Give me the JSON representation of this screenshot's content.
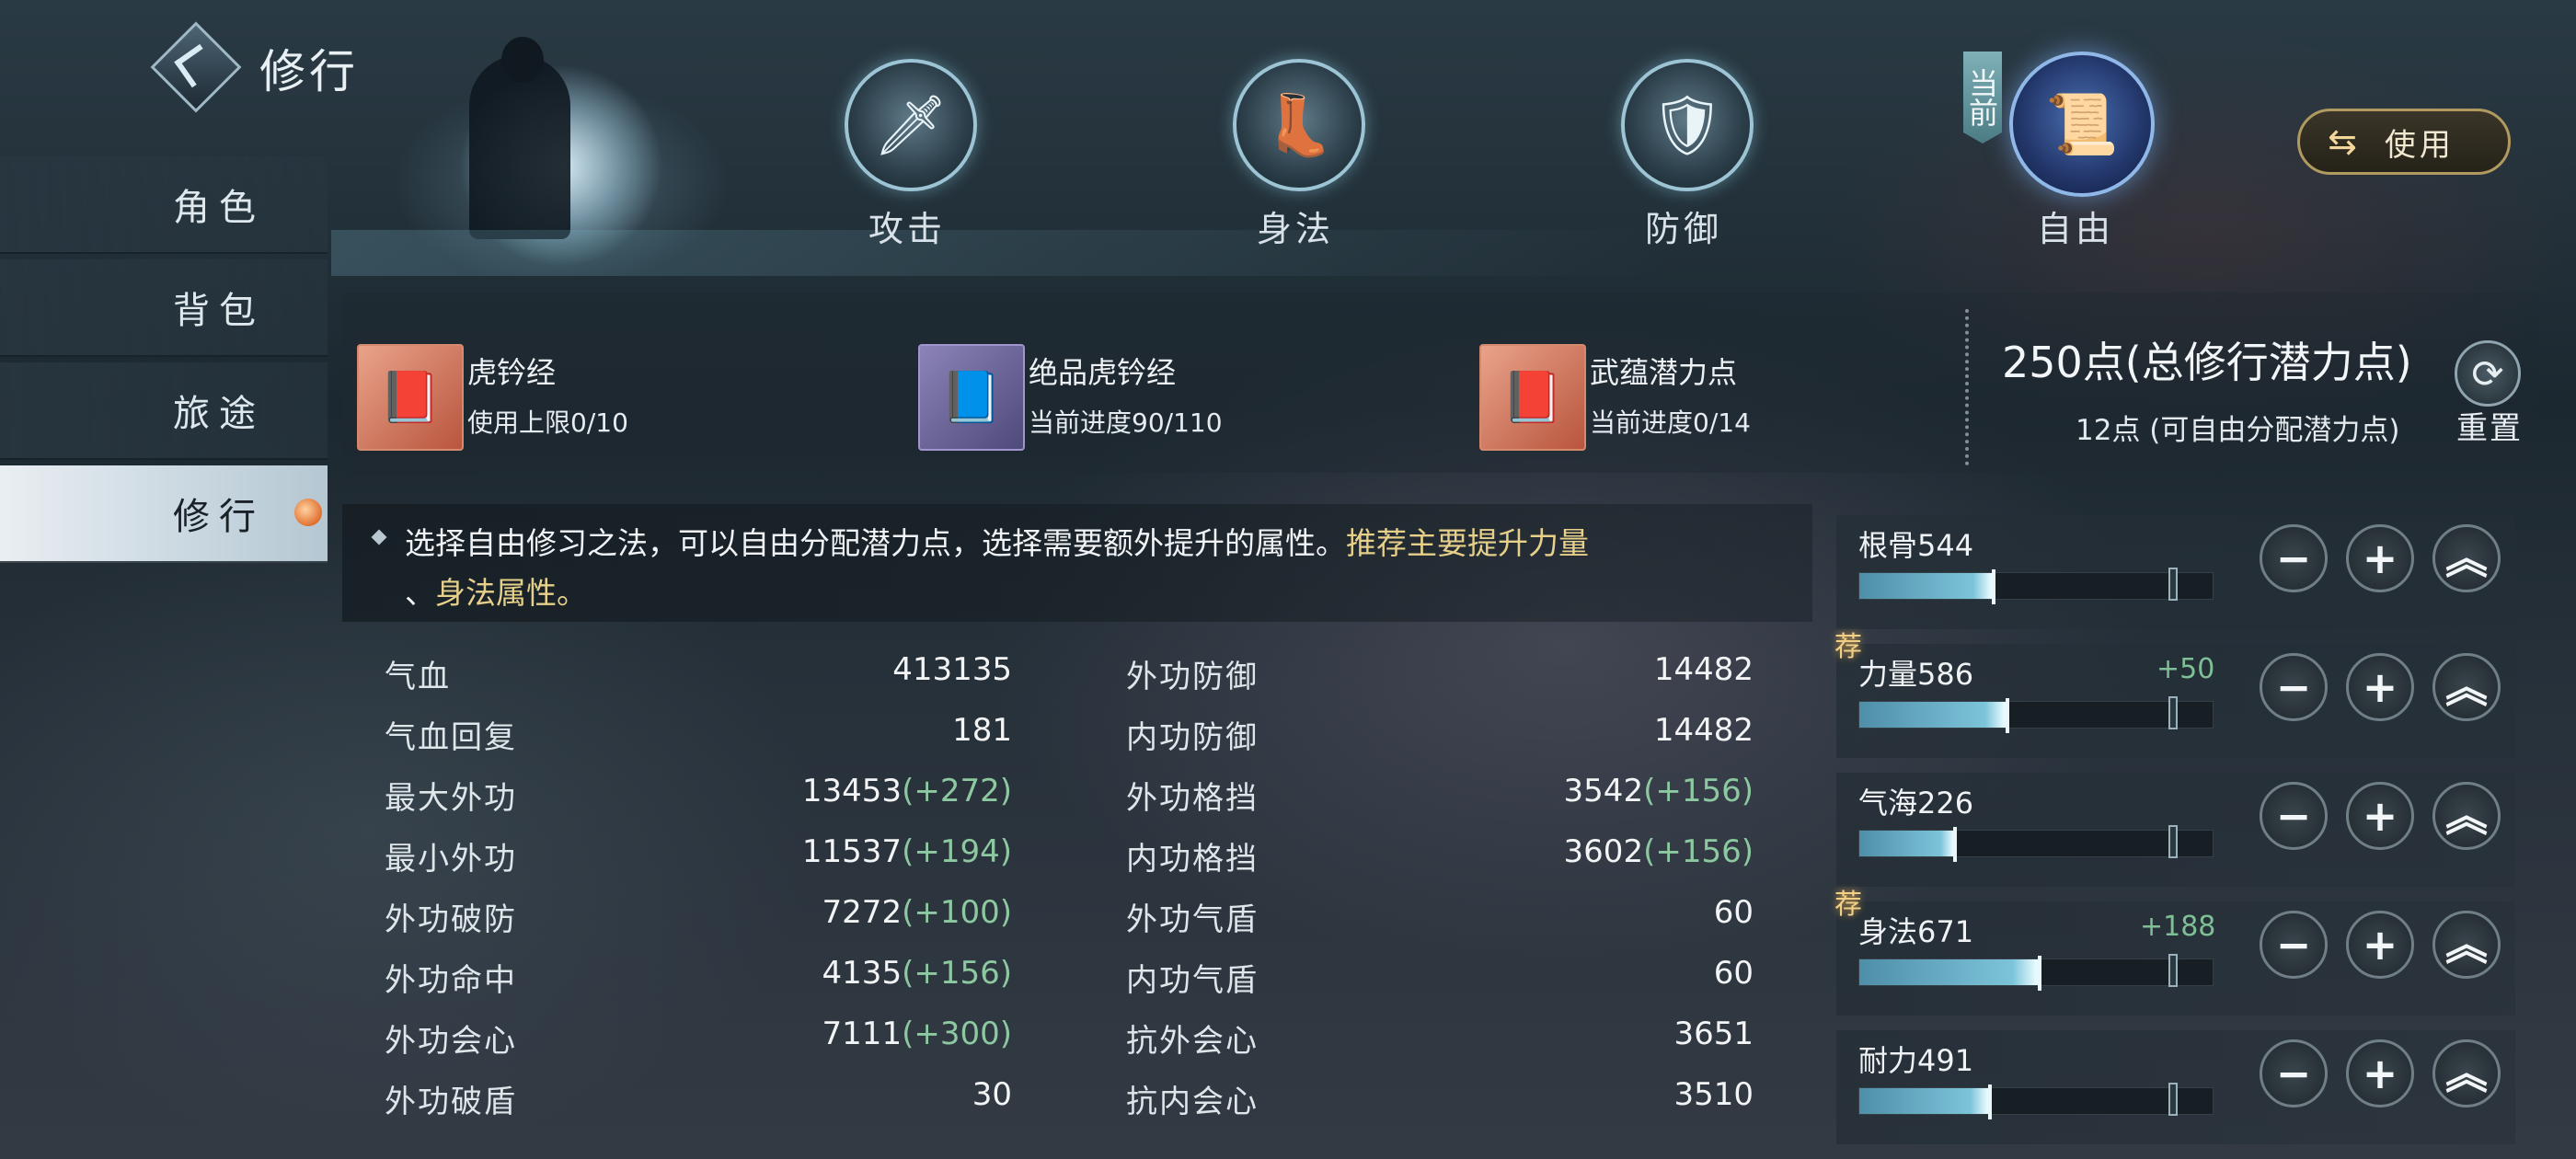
{
  "header": {
    "title": "修行"
  },
  "sidebar": {
    "items": [
      {
        "label": "角色"
      },
      {
        "label": "背包"
      },
      {
        "label": "旅途"
      },
      {
        "label": "修行"
      }
    ]
  },
  "tabs": [
    {
      "label": "攻击",
      "icon": "sword-icon"
    },
    {
      "label": "身法",
      "icon": "boot-icon"
    },
    {
      "label": "防御",
      "icon": "shield-icon"
    },
    {
      "label": "自由",
      "icon": "book-quill-icon"
    }
  ],
  "current_badge": "当前",
  "use_button": {
    "label": "使用"
  },
  "books": [
    {
      "name": "虎钤经",
      "sub": "使用上限0/10"
    },
    {
      "name": "绝品虎钤经",
      "sub": "当前进度90/110"
    },
    {
      "name": "武蕴潜力点",
      "sub": "当前进度0/14"
    }
  ],
  "points": {
    "total": "250点(总修行潜力点)",
    "free": "12点 (可自由分配潜力点)",
    "reset_label": "重置"
  },
  "notice": {
    "line1_plain": "选择自由修习之法，可以自由分配潜力点，选择需要额外提升的属性。",
    "line1_highlight": "推荐主要提升力量",
    "line2_prefix": "、",
    "line2_highlight": "身法属性。"
  },
  "stats_left": [
    {
      "label": "气血",
      "value": "413135",
      "bonus": ""
    },
    {
      "label": "气血回复",
      "value": "181",
      "bonus": ""
    },
    {
      "label": "最大外功",
      "value": "13453",
      "bonus": "(+272)"
    },
    {
      "label": "最小外功",
      "value": "11537",
      "bonus": "(+194)"
    },
    {
      "label": "外功破防",
      "value": "7272",
      "bonus": "(+100)"
    },
    {
      "label": "外功命中",
      "value": "4135",
      "bonus": "(+156)"
    },
    {
      "label": "外功会心",
      "value": "7111",
      "bonus": "(+300)"
    },
    {
      "label": "外功破盾",
      "value": "30",
      "bonus": ""
    }
  ],
  "stats_right": [
    {
      "label": "外功防御",
      "value": "14482",
      "bonus": ""
    },
    {
      "label": "内功防御",
      "value": "14482",
      "bonus": ""
    },
    {
      "label": "外功格挡",
      "value": "3542",
      "bonus": "(+156)"
    },
    {
      "label": "内功格挡",
      "value": "3602",
      "bonus": "(+156)"
    },
    {
      "label": "外功气盾",
      "value": "60",
      "bonus": ""
    },
    {
      "label": "内功气盾",
      "value": "60",
      "bonus": ""
    },
    {
      "label": "抗外会心",
      "value": "3651",
      "bonus": ""
    },
    {
      "label": "抗内会心",
      "value": "3510",
      "bonus": ""
    }
  ],
  "attributes": [
    {
      "label": "根骨544",
      "plus": "",
      "recommended": false,
      "fill_percent": 38
    },
    {
      "label": "力量586",
      "plus": "+50",
      "recommended": true,
      "fill_percent": 42
    },
    {
      "label": "气海226",
      "plus": "",
      "recommended": false,
      "fill_percent": 27
    },
    {
      "label": "身法671",
      "plus": "+188",
      "recommended": true,
      "fill_percent": 51
    },
    {
      "label": "耐力491",
      "plus": "",
      "recommended": false,
      "fill_percent": 37
    }
  ],
  "recommend_badge": "荐",
  "buttons": {
    "minus": "−",
    "plus": "+",
    "max": "︽"
  },
  "colors": {
    "accent": "#7cc4da",
    "bonus": "#8cc8a0",
    "highlight": "#e6d08a"
  }
}
